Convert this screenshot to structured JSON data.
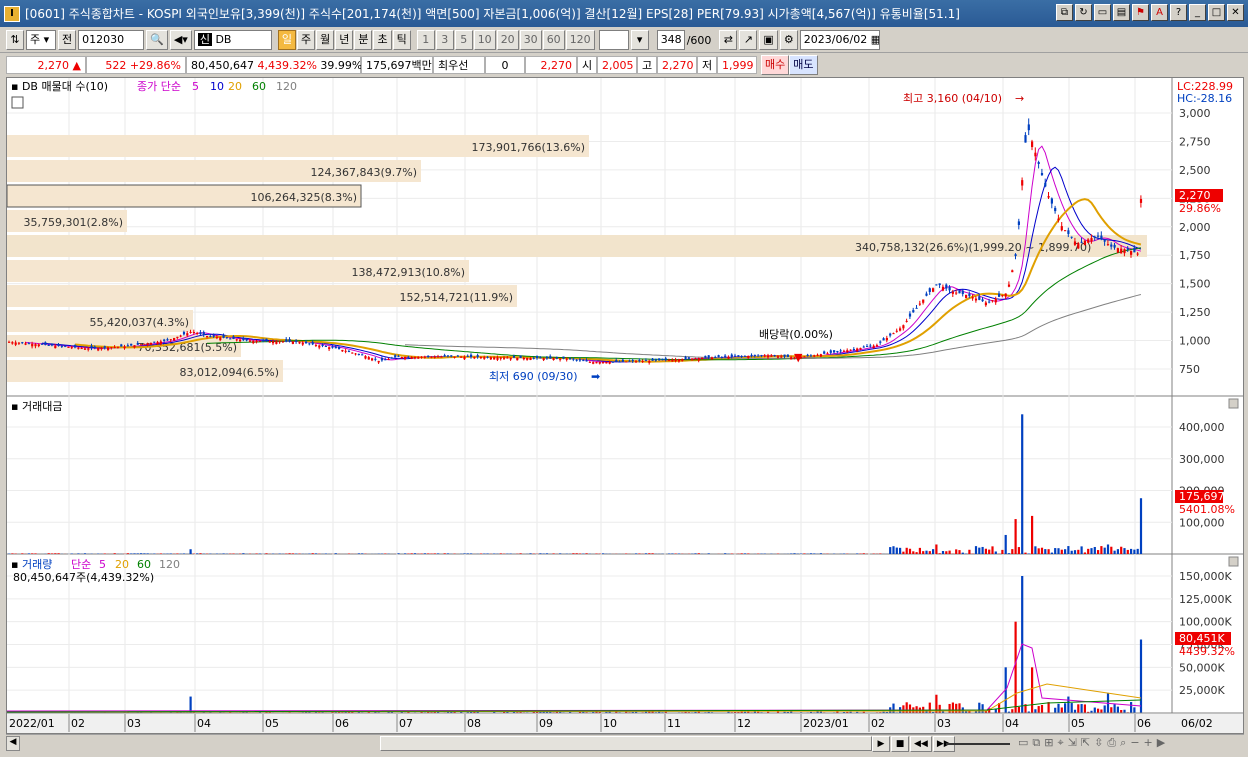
{
  "window": {
    "title": "[0601] 주식종합차트 - KOSPI 외국인보유[3,399(천)] 주식수[201,174(천)] 액면[500] 자본금[1,006(억)] 결산[12월] EPS[28] PER[79.93] 시가총액[4,567(억)] 유통비율[51.1]"
  },
  "toolbar": {
    "market": "주",
    "period": "전",
    "code": "012030",
    "name_prefix": "신",
    "name": "DB",
    "buttons": [
      "일",
      "주",
      "월",
      "년",
      "분",
      "초",
      "틱"
    ],
    "active": "일",
    "intervals": [
      "1",
      "3",
      "5",
      "10",
      "20",
      "30",
      "60",
      "120"
    ],
    "count": "348",
    "count_max": "/600",
    "date": "2023/06/02"
  },
  "quote": {
    "price": "2,270",
    "arrow": "▲",
    "change": "522",
    "change_pct": "+29.86%",
    "volume": "80,450,647",
    "volume_pct": "4,439.32%",
    "turnover_pct": "39.99%",
    "amount": "175,697백만",
    "ask_label": "최우선",
    "ask": "0",
    "bid": "2,270",
    "open_label": "시",
    "open": "2,005",
    "high_label": "고",
    "high": "2,270",
    "low_label": "저",
    "low": "1,999",
    "buy": "매수",
    "sell": "매도"
  },
  "price_panel": {
    "label": "DB 매물대 수(10)",
    "ma_label": "종가 단순",
    "ma_periods": [
      "5",
      "10",
      "20",
      "60",
      "120"
    ],
    "ma_colors": [
      "#cc00cc",
      "#0000cc",
      "#e0a000",
      "#008000",
      "#808080"
    ],
    "lc": "LC:228.99",
    "hc": "HC:-28.16",
    "price_tag": "2,270",
    "pct_tag": "29.86%",
    "y_ticks": [
      "3,000",
      "2,750",
      "2,500",
      "2,250",
      "2,000",
      "1,750",
      "1,500",
      "1,250",
      "1,000",
      "750"
    ],
    "high_annot": "최고 3,160 (04/10)",
    "low_annot": "최저 690 (09/30)",
    "div_annot": "배당락(0.00%)",
    "volume_profile": [
      {
        "label": "173,901,766(13.6%)",
        "frac": 0.97
      },
      {
        "label": "124,367,843(9.7%)",
        "frac": 0.69
      },
      {
        "label": "106,264,325(8.3%)",
        "frac": 0.59
      },
      {
        "label": "35,759,301(2.8%)",
        "frac": 0.2
      },
      {
        "label": "340,758,132(26.6%)(1,999.20 ~ 1,899.70)",
        "frac": 1.9
      },
      {
        "label": "138,472,913(10.8%)",
        "frac": 0.77
      },
      {
        "label": "152,514,721(11.9%)",
        "frac": 0.85
      },
      {
        "label": "55,420,037(4.3%)",
        "frac": 0.31
      },
      {
        "label": "70,352,681(5.5%)",
        "frac": 0.39
      },
      {
        "label": "83,012,094(6.5%)",
        "frac": 0.46
      }
    ]
  },
  "amount_panel": {
    "label": "거래대금",
    "y_ticks": [
      "400,000",
      "300,000",
      "200,000",
      "100,000"
    ],
    "tag": "175,697",
    "tag_pct": "5401.08%"
  },
  "volume_panel": {
    "label": "거래량",
    "ma_label": "단순",
    "ma_periods": [
      "5",
      "20",
      "60",
      "120"
    ],
    "ma_colors": [
      "#cc00cc",
      "#e0a000",
      "#008000",
      "#808080"
    ],
    "sub": "80,450,647주(4,439.32%)",
    "y_ticks": [
      "150,000K",
      "125,000K",
      "100,000K",
      "75,000K",
      "50,000K",
      "25,000K"
    ],
    "tag": "80,451K",
    "tag_pct": "4439.32%"
  },
  "x_axis": [
    "2022/01",
    "02",
    "03",
    "04",
    "05",
    "06",
    "07",
    "08",
    "09",
    "10",
    "11",
    "12",
    "2023/01",
    "02",
    "03",
    "04",
    "05",
    "06",
    "06/02"
  ]
}
